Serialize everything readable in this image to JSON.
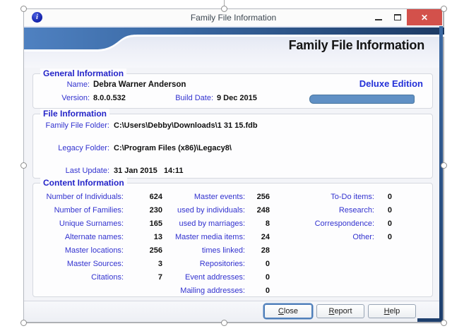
{
  "titlebar": {
    "title": "Family File Information",
    "controls": {
      "minimize": "minimize",
      "maximize": "maximize",
      "close": "close"
    }
  },
  "header": {
    "title": "Family File Information"
  },
  "general": {
    "section_title": "General Information",
    "name_label": "Name:",
    "name_value": "Debra Warner Anderson",
    "edition": "Deluxe Edition",
    "version_label": "Version:",
    "version_value": "8.0.0.532",
    "build_date_label": "Build Date:",
    "build_date_value": "9 Dec 2015"
  },
  "file": {
    "section_title": "File Information",
    "rows": [
      {
        "label": "Family File Folder:",
        "value": "C:\\Users\\Debby\\Downloads\\1 31 15.fdb"
      },
      {
        "label": "Legacy Folder:",
        "value": "C:\\Program Files (x86)\\Legacy8\\"
      },
      {
        "label": "Last Update:",
        "value": "31 Jan 2015   14:11"
      }
    ]
  },
  "content": {
    "section_title": "Content Information",
    "col1": [
      {
        "label": "Number of Individuals:",
        "value": "624"
      },
      {
        "label": "Number of Families:",
        "value": "230"
      },
      {
        "label": "Unique Surnames:",
        "value": "165"
      },
      {
        "label": "Alternate names:",
        "value": "13"
      },
      {
        "label": "Master locations:",
        "value": "256"
      },
      {
        "label": "Master Sources:",
        "value": "3"
      },
      {
        "label": "Citations:",
        "value": "7"
      }
    ],
    "col2": [
      {
        "label": "Master events:",
        "value": "256"
      },
      {
        "label": "used by individuals:",
        "value": "248"
      },
      {
        "label": "used by marriages:",
        "value": "8"
      },
      {
        "label": "Master media items:",
        "value": "24"
      },
      {
        "label": "times linked:",
        "value": "28"
      },
      {
        "label": "Repositories:",
        "value": "0"
      },
      {
        "label": "Event addresses:",
        "value": "0"
      },
      {
        "label": "Mailing addresses:",
        "value": "0"
      }
    ],
    "col3": [
      {
        "label": "To-Do items:",
        "value": "0"
      },
      {
        "label": "Research:",
        "value": "0"
      },
      {
        "label": "Correspondence:",
        "value": "0"
      },
      {
        "label": "Other:",
        "value": "0"
      }
    ]
  },
  "footer": {
    "buttons": [
      {
        "key": "C",
        "rest": "lose"
      },
      {
        "key": "R",
        "rest": "eport"
      },
      {
        "key": "H",
        "rest": "elp"
      }
    ]
  },
  "colors": {
    "label_blue": "#3232cf",
    "section_title_blue": "#2424c8",
    "banner_navy": "#1c3a64",
    "banner_blue": "#4f81c1",
    "progress_fill": "#6090c5",
    "close_button_red": "#d3514b"
  }
}
